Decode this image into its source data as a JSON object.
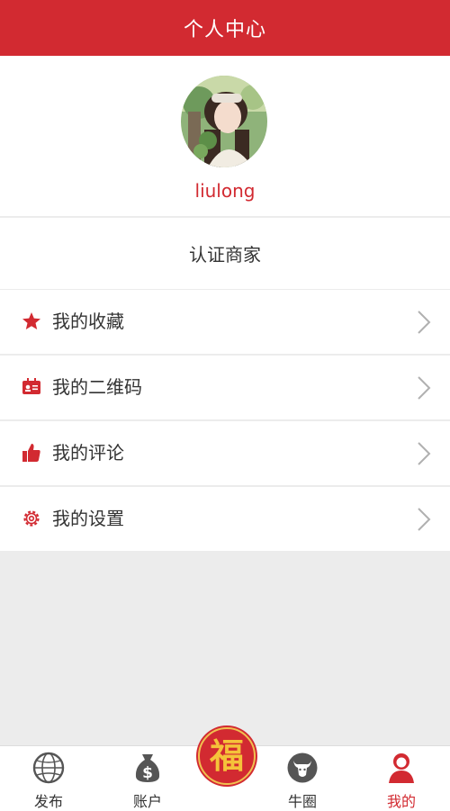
{
  "header": {
    "title": "个人中心"
  },
  "profile": {
    "username": "liulong"
  },
  "verify": {
    "label": "认证商家"
  },
  "menu": {
    "items": [
      {
        "label": "我的收藏",
        "icon": "star-icon"
      },
      {
        "label": "我的二维码",
        "icon": "id-card-icon"
      },
      {
        "label": "我的评论",
        "icon": "thumbs-up-icon"
      },
      {
        "label": "我的设置",
        "icon": "gear-icon"
      }
    ]
  },
  "tabbar": {
    "items": [
      {
        "label": "发布",
        "icon": "globe-icon"
      },
      {
        "label": "账户",
        "icon": "money-bag-icon"
      },
      {
        "label": "牛圈",
        "icon": "bull-icon"
      },
      {
        "label": "我的",
        "icon": "user-icon"
      }
    ],
    "center": {
      "glyph": "福"
    }
  },
  "colors": {
    "accent": "#d22a31",
    "background": "#ececec",
    "gold": "#f5c23a"
  }
}
